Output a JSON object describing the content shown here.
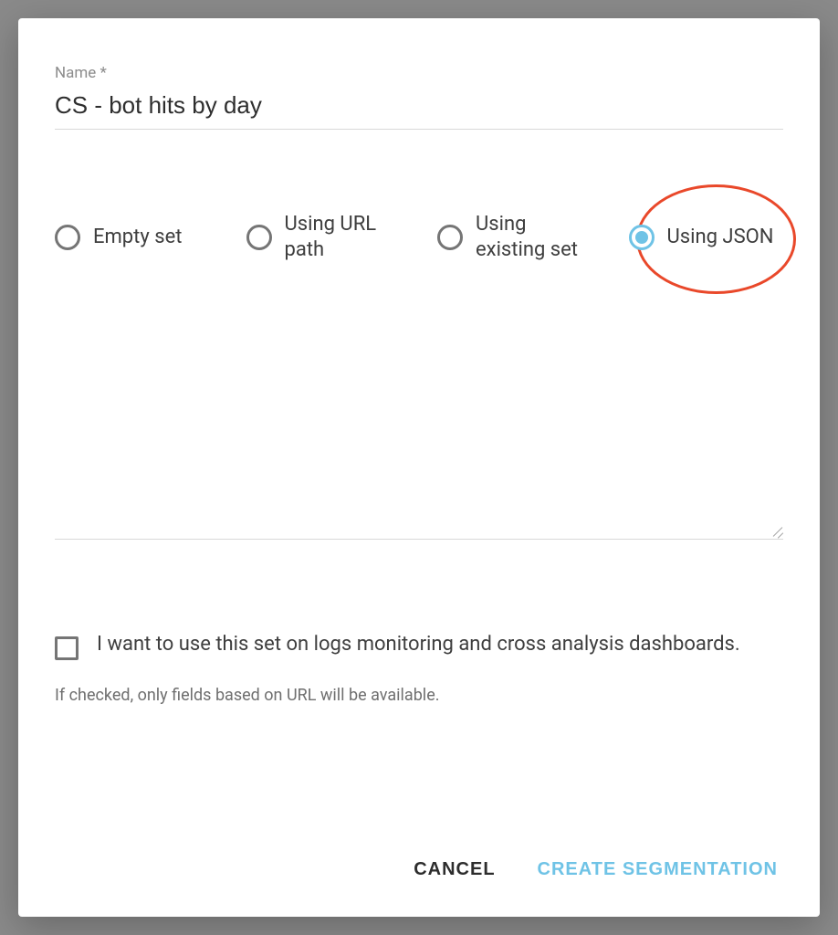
{
  "form": {
    "name_label": "Name *",
    "name_value": "CS - bot hits by day"
  },
  "options": {
    "empty_set": "Empty set",
    "url_path": "Using URL path",
    "existing_set": "Using existing set",
    "using_json": "Using JSON",
    "selected": "using_json"
  },
  "checkbox": {
    "label": "I want to use this set on logs monitoring and cross analysis dashboards.",
    "helper": "If checked, only fields based on URL will be available."
  },
  "actions": {
    "cancel": "Cancel",
    "create": "Create Segmentation"
  },
  "annotation": {
    "highlight_option": "using_json"
  }
}
